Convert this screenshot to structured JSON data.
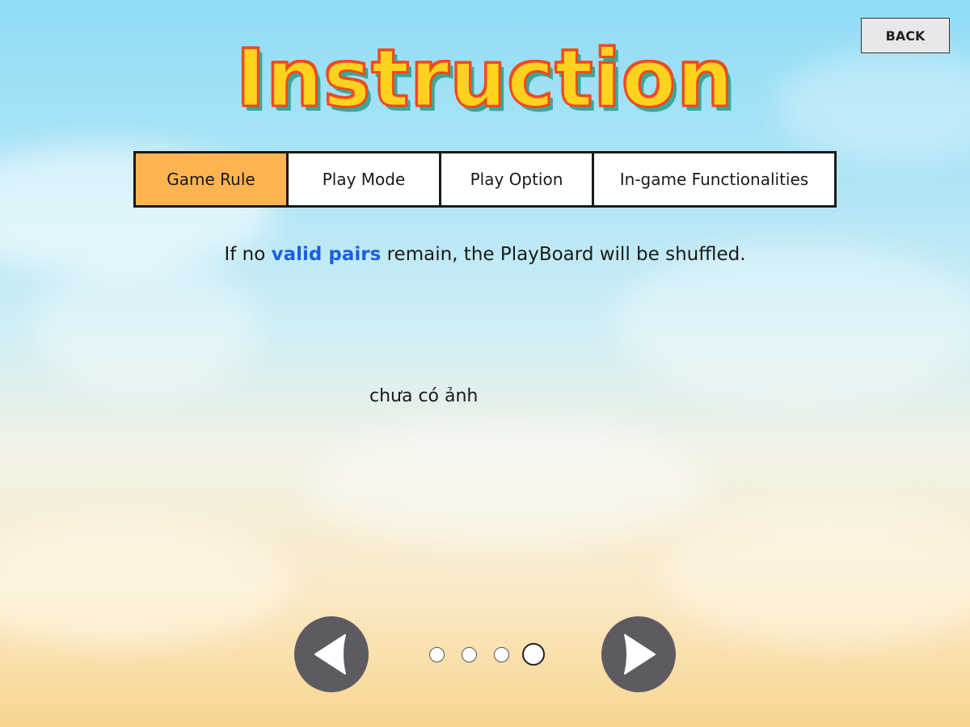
{
  "header": {
    "title": "Instruction",
    "back_label": "BACK"
  },
  "tabs": [
    {
      "label": "Game Rule",
      "active": true
    },
    {
      "label": "Play Mode",
      "active": false
    },
    {
      "label": "Play Option",
      "active": false
    },
    {
      "label": "In-game Functionalities",
      "active": false
    }
  ],
  "content": {
    "rule_before": "If no ",
    "rule_highlight": "valid pairs",
    "rule_after": " remain, the PlayBoard will be shuffled.",
    "image_placeholder": "chưa có ảnh"
  },
  "pagination": {
    "total_pages": 4,
    "current_page": 4,
    "prev_icon": "triangle-left-icon",
    "next_icon": "triangle-right-icon"
  },
  "colors": {
    "active_tab": "#fbb44f",
    "highlight_text": "#1a5fe6",
    "title_fill": "#ffd21f",
    "title_outline": "#f04a1e",
    "title_shadow": "#3aa79b",
    "nav_button": "#5e5a61"
  }
}
